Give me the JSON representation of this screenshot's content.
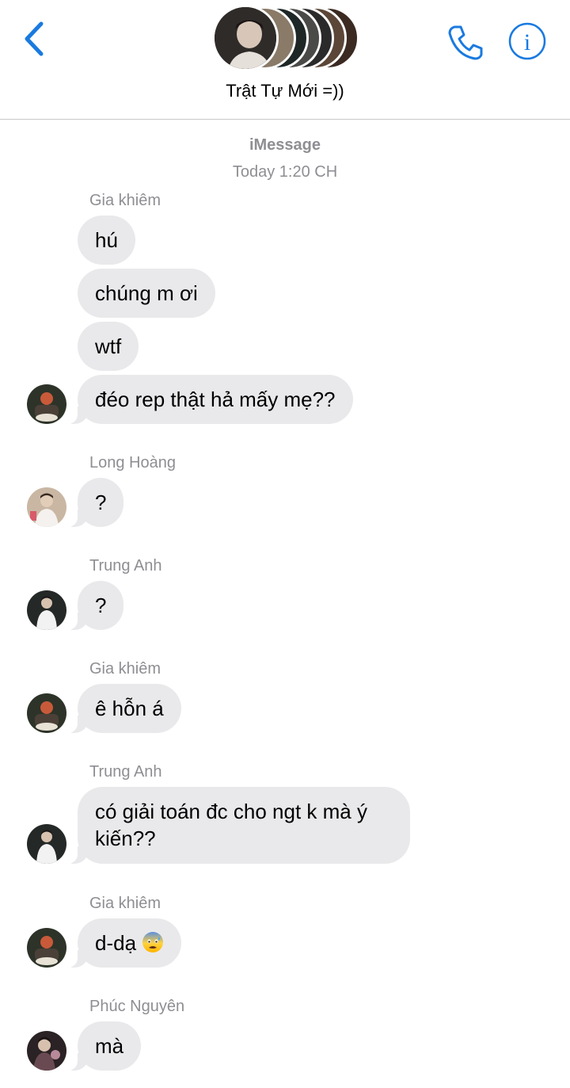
{
  "header": {
    "group_name": "Trật Tự Mới =))",
    "back_icon": "chevron-left-icon",
    "call_icon": "phone-icon",
    "info_icon": "info-icon",
    "accent_color": "#1a7ae0"
  },
  "thread": {
    "service": "iMessage",
    "timestamp": "Today 1:20 CH"
  },
  "messages": {
    "g1": {
      "sender": "Gia khiêm",
      "m1": "hú",
      "m2": "chúng m ơi",
      "m3": "wtf",
      "m4": "đéo rep thật hả mấy mẹ??"
    },
    "g2": {
      "sender": "Long Hoàng",
      "m1": "?"
    },
    "g3": {
      "sender": "Trung Anh",
      "m1": "?"
    },
    "g4": {
      "sender": "Gia khiêm",
      "m1": "ê hỗn á"
    },
    "g5": {
      "sender": "Trung Anh",
      "m1": "có giải toán đc cho ngt k mà ý kiến??"
    },
    "g6": {
      "sender": "Gia khiêm",
      "m1": "d-dạ",
      "emoji": "anxious-face-with-sweat"
    },
    "g7": {
      "sender": "Phúc Nguyên",
      "m1": "mà"
    }
  },
  "colors": {
    "bubble_incoming": "#e9e9eb",
    "meta_text": "#8e8e93"
  }
}
